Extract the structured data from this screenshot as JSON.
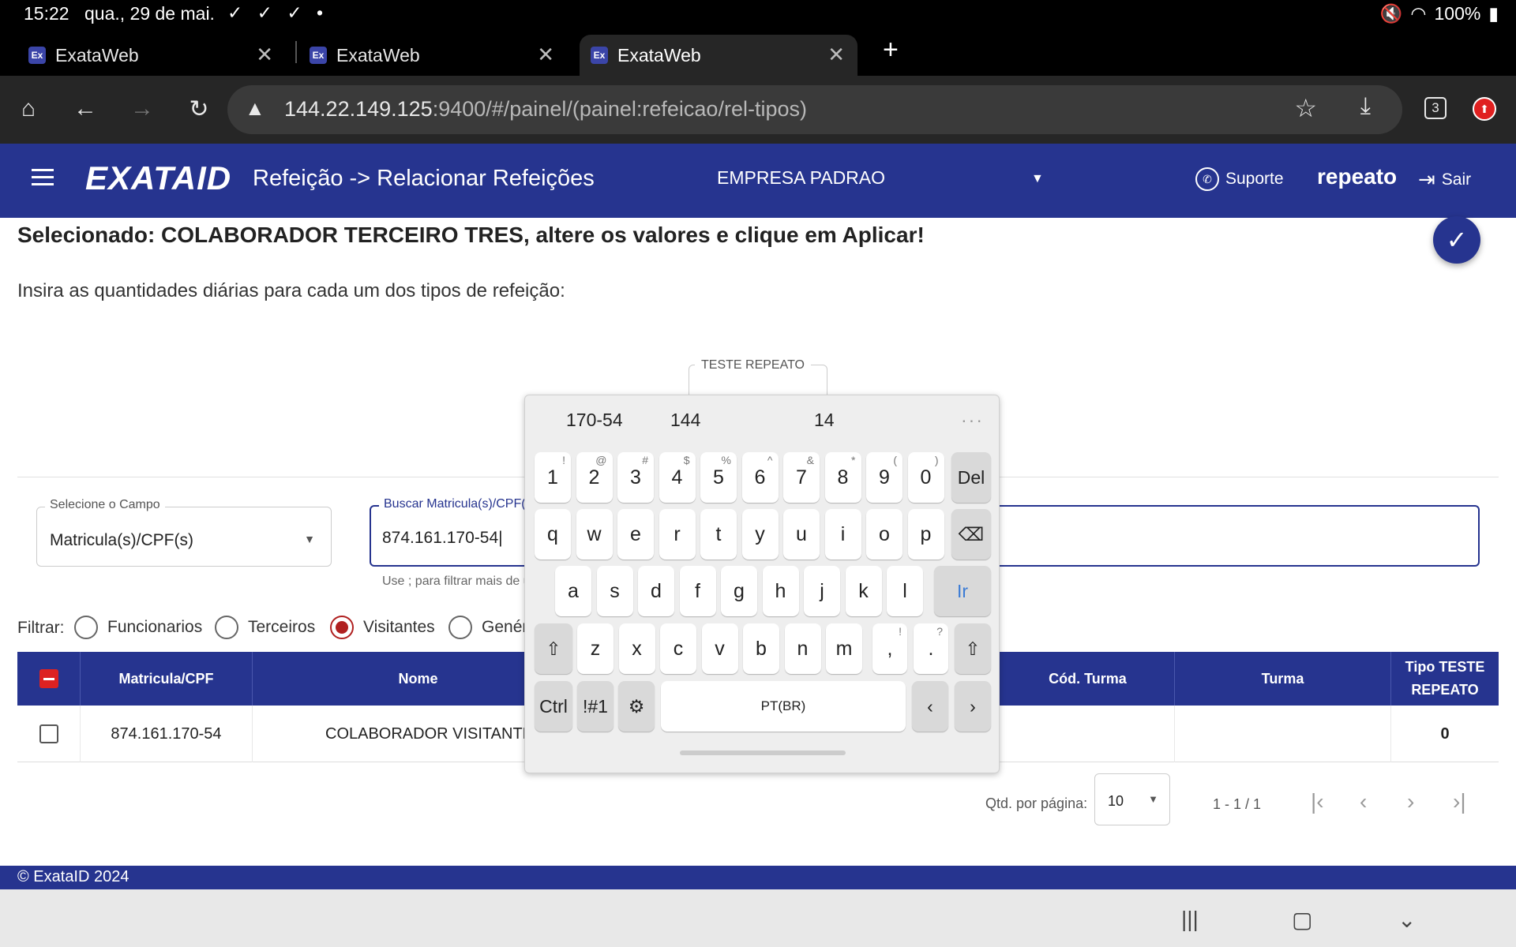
{
  "status_bar": {
    "time": "15:22",
    "date": "qua., 29 de mai.",
    "notifications": "✓ ✓ ✓ •",
    "battery": "100%"
  },
  "tabs": [
    {
      "title": "ExataWeb",
      "favicon": "Ex"
    },
    {
      "title": "ExataWeb",
      "favicon": "Ex"
    },
    {
      "title": "ExataWeb",
      "favicon": "Ex"
    }
  ],
  "browser": {
    "url_host": "144.22.149.125",
    "url_rest": ":9400/#/painel/(painel:refeicao/rel-tipos)",
    "tab_count": "3"
  },
  "app": {
    "logo": "EXATAID",
    "page_title": "Refeição -> Relacionar Refeições",
    "company": "EMPRESA PADRAO",
    "support_label": "Suporte",
    "username": "repeato",
    "logout_label": "Sair",
    "accent_color": "#26348f"
  },
  "content": {
    "selected_text": "Selecionado: COLABORADOR TERCEIRO TRES, altere os valores e clique em Aplicar!",
    "instruction": "Insira as quantidades diárias para cada um dos tipos de refeição:",
    "meal_type_label": "TESTE REPEATO"
  },
  "search": {
    "field_label": "Selecione o Campo",
    "field_value": "Matricula(s)/CPF(s)",
    "input_label": "Buscar Matricula(s)/CPF(s)",
    "input_value": "874.161.170-54",
    "hint": "Use ; para filtrar mais de u"
  },
  "filter": {
    "label": "Filtrar:",
    "options": [
      "Funcionarios",
      "Terceiros",
      "Visitantes",
      "Genér"
    ],
    "selected": "Visitantes"
  },
  "table": {
    "headers": {
      "matricula": "Matricula/CPF",
      "nome": "Nome",
      "cod_turma": "Cód. Turma",
      "turma": "Turma",
      "tipo": "Tipo TESTE REPEATO"
    },
    "rows": [
      {
        "matricula": "874.161.170-54",
        "nome": "COLABORADOR VISITANTE T",
        "cod_turma": "",
        "turma": "",
        "tipo": "0"
      }
    ]
  },
  "paginator": {
    "per_page_label": "Qtd. por página:",
    "per_page": "10",
    "range": "1 - 1 / 1"
  },
  "footer": "© ExataID 2024",
  "keyboard": {
    "suggestions": [
      "170-54",
      "144",
      "14"
    ],
    "number_row": [
      {
        "k": "1",
        "s": "!"
      },
      {
        "k": "2",
        "s": "@"
      },
      {
        "k": "3",
        "s": "#"
      },
      {
        "k": "4",
        "s": "$"
      },
      {
        "k": "5",
        "s": "%"
      },
      {
        "k": "6",
        "s": "^"
      },
      {
        "k": "7",
        "s": "&"
      },
      {
        "k": "8",
        "s": "*"
      },
      {
        "k": "9",
        "s": "("
      },
      {
        "k": "0",
        "s": ")"
      }
    ],
    "del_label": "Del",
    "row_q": [
      "q",
      "w",
      "e",
      "r",
      "t",
      "y",
      "u",
      "i",
      "o",
      "p"
    ],
    "row_a": [
      "a",
      "s",
      "d",
      "f",
      "g",
      "h",
      "j",
      "k",
      "l"
    ],
    "go_label": "Ir",
    "row_z": [
      "z",
      "x",
      "c",
      "v",
      "b",
      "n",
      "m"
    ],
    "comma_sup": "!",
    "period_sup": "?",
    "ctrl_label": "Ctrl",
    "symbols_label": "!#1",
    "space_label": "PT(BR)"
  }
}
